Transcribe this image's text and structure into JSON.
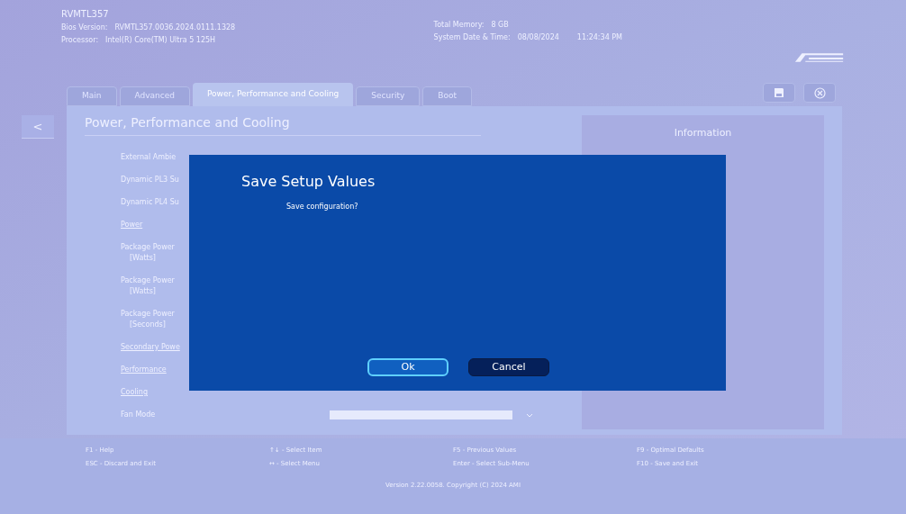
{
  "header": {
    "model": "RVMTL357",
    "bios_version": {
      "label": "Bios Version:",
      "value": "RVMTL357.0036.2024.0111.1328"
    },
    "processor": {
      "label": "Processor:",
      "value": "Intel(R) Core(TM) Ultra 5 125H"
    },
    "total_memory": {
      "label": "Total Memory:",
      "value": "8 GB"
    },
    "system_date_time": {
      "label": "System Date & Time:",
      "date": "08/08/2024",
      "time": "11:24:34 PM"
    }
  },
  "tabs": [
    {
      "label": "Main",
      "selected": false
    },
    {
      "label": "Advanced",
      "selected": false
    },
    {
      "label": "Power, Performance and Cooling",
      "selected": true
    },
    {
      "label": "Security",
      "selected": false
    },
    {
      "label": "Boot",
      "selected": false
    }
  ],
  "back_button": "<",
  "page_title": "Power, Performance and Cooling",
  "settings": [
    {
      "kind": "setting",
      "lines": [
        "External Ambie"
      ]
    },
    {
      "kind": "setting",
      "lines": [
        "Dynamic PL3 Su"
      ]
    },
    {
      "kind": "setting",
      "lines": [
        "Dynamic PL4 Su"
      ]
    },
    {
      "kind": "heading",
      "lines": [
        "Power"
      ]
    },
    {
      "kind": "setting",
      "lines": [
        "Package Power",
        "[Watts]"
      ]
    },
    {
      "kind": "setting",
      "lines": [
        "Package Power",
        "[Watts]"
      ]
    },
    {
      "kind": "setting",
      "lines": [
        "Package Power",
        "[Seconds]"
      ]
    },
    {
      "kind": "heading",
      "lines": [
        "Secondary Powe"
      ]
    },
    {
      "kind": "heading",
      "lines": [
        "Performance"
      ]
    },
    {
      "kind": "heading",
      "lines": [
        "Cooling"
      ]
    },
    {
      "kind": "select",
      "lines": [
        "Fan Mode"
      ]
    }
  ],
  "information": {
    "title": "Information"
  },
  "dialog": {
    "title": "Save Setup Values",
    "message": "Save configuration?",
    "buttons": [
      {
        "label": "Ok",
        "focused": true
      },
      {
        "label": "Cancel",
        "focused": false
      }
    ]
  },
  "footer": {
    "hints": [
      [
        "F1 - Help",
        "ESC - Discard and Exit"
      ],
      [
        "↑↓ - Select Item",
        "↔ - Select Menu"
      ],
      [
        "F5 - Previous Values",
        "Enter - Select Sub-Menu"
      ],
      [
        "F9 - Optimal Defaults",
        "F10 - Save and Exit"
      ]
    ],
    "version": "Version 2.22.0058. Copyright (C) 2024 AMI"
  }
}
